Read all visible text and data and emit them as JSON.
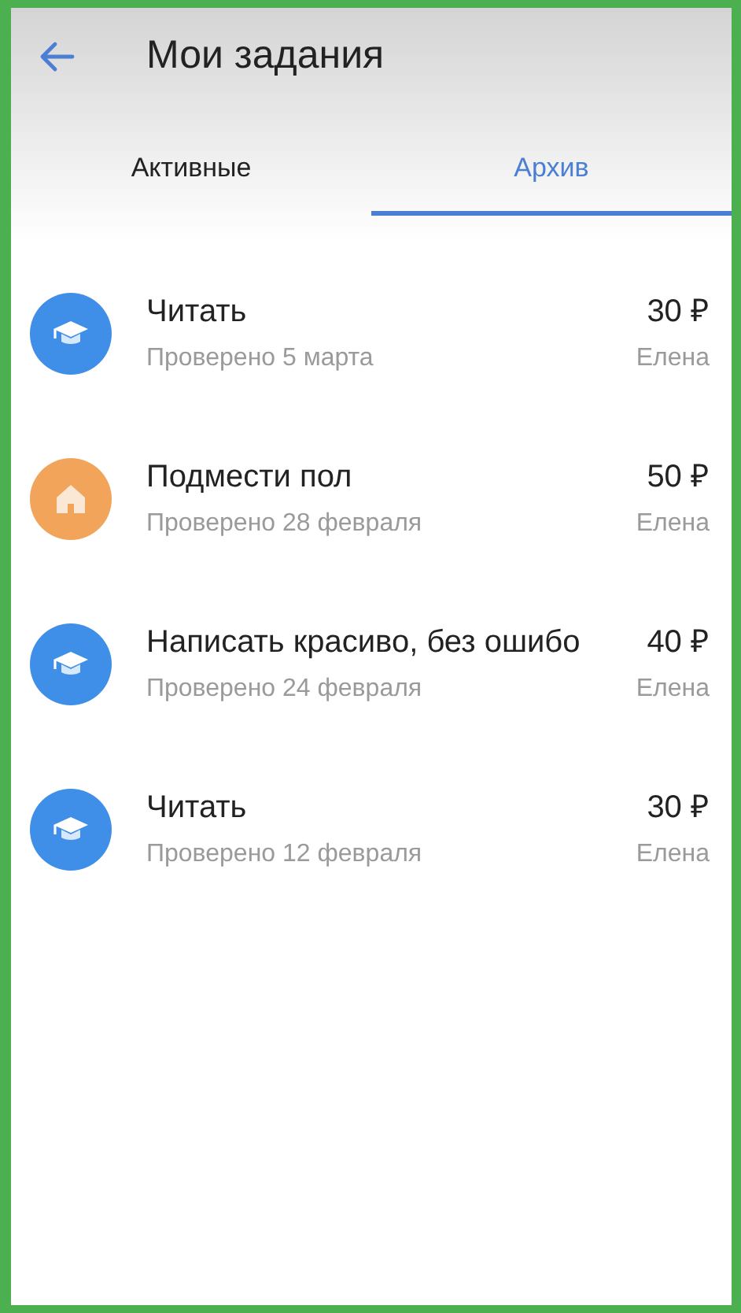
{
  "header": {
    "title": "Мои задания"
  },
  "tabs": [
    {
      "label": "Активные",
      "selected": false
    },
    {
      "label": "Архив",
      "selected": true
    }
  ],
  "tasks": [
    {
      "kind": "study",
      "title": "Читать",
      "status": "Проверено 5 марта",
      "price": "30 ₽",
      "assignee": "Елена"
    },
    {
      "kind": "home",
      "title": "Подмести пол",
      "status": "Проверено 28 февраля",
      "price": "50 ₽",
      "assignee": "Елена"
    },
    {
      "kind": "study",
      "title": "Написать красиво, без ошибо",
      "status": "Проверено 24 февраля",
      "price": "40 ₽",
      "assignee": "Елена"
    },
    {
      "kind": "study",
      "title": "Читать",
      "status": "Проверено 12 февраля",
      "price": "30 ₽",
      "assignee": "Елена"
    }
  ]
}
